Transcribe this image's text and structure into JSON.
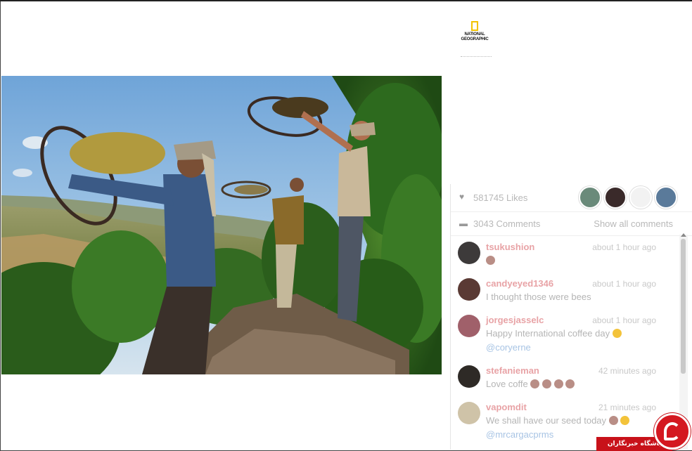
{
  "post": {
    "brand_logo_text": "NATIONAL GEOGRAPHIC",
    "likes_text": "581745 Likes",
    "comments_text": "3043 Comments",
    "show_all_label": "Show all comments"
  },
  "comments": [
    {
      "user": "tsukushion",
      "time": "about 1 hour ago",
      "text": "",
      "emoji_only": true,
      "mention": ""
    },
    {
      "user": "candyeyed1346",
      "time": "about 1 hour ago",
      "text": "I thought those were bees",
      "mention": ""
    },
    {
      "user": "jorgesjasselc",
      "time": "about 1 hour ago",
      "text": "Happy International coffee day",
      "mention": "@coryerne"
    },
    {
      "user": "stefanieman",
      "time": "42 minutes ago",
      "text": "Love coffe",
      "mention": ""
    },
    {
      "user": "vapomdit",
      "time": "21 minutes ago",
      "text": "We shall have our seed today",
      "mention": "@mrcargacprms"
    }
  ],
  "watermark": {
    "text": "باشگاه خبرنگاران"
  },
  "colors": {
    "username": "#e8a3a6",
    "mention": "#a8c4e4",
    "watermark_red": "#c8121a"
  }
}
